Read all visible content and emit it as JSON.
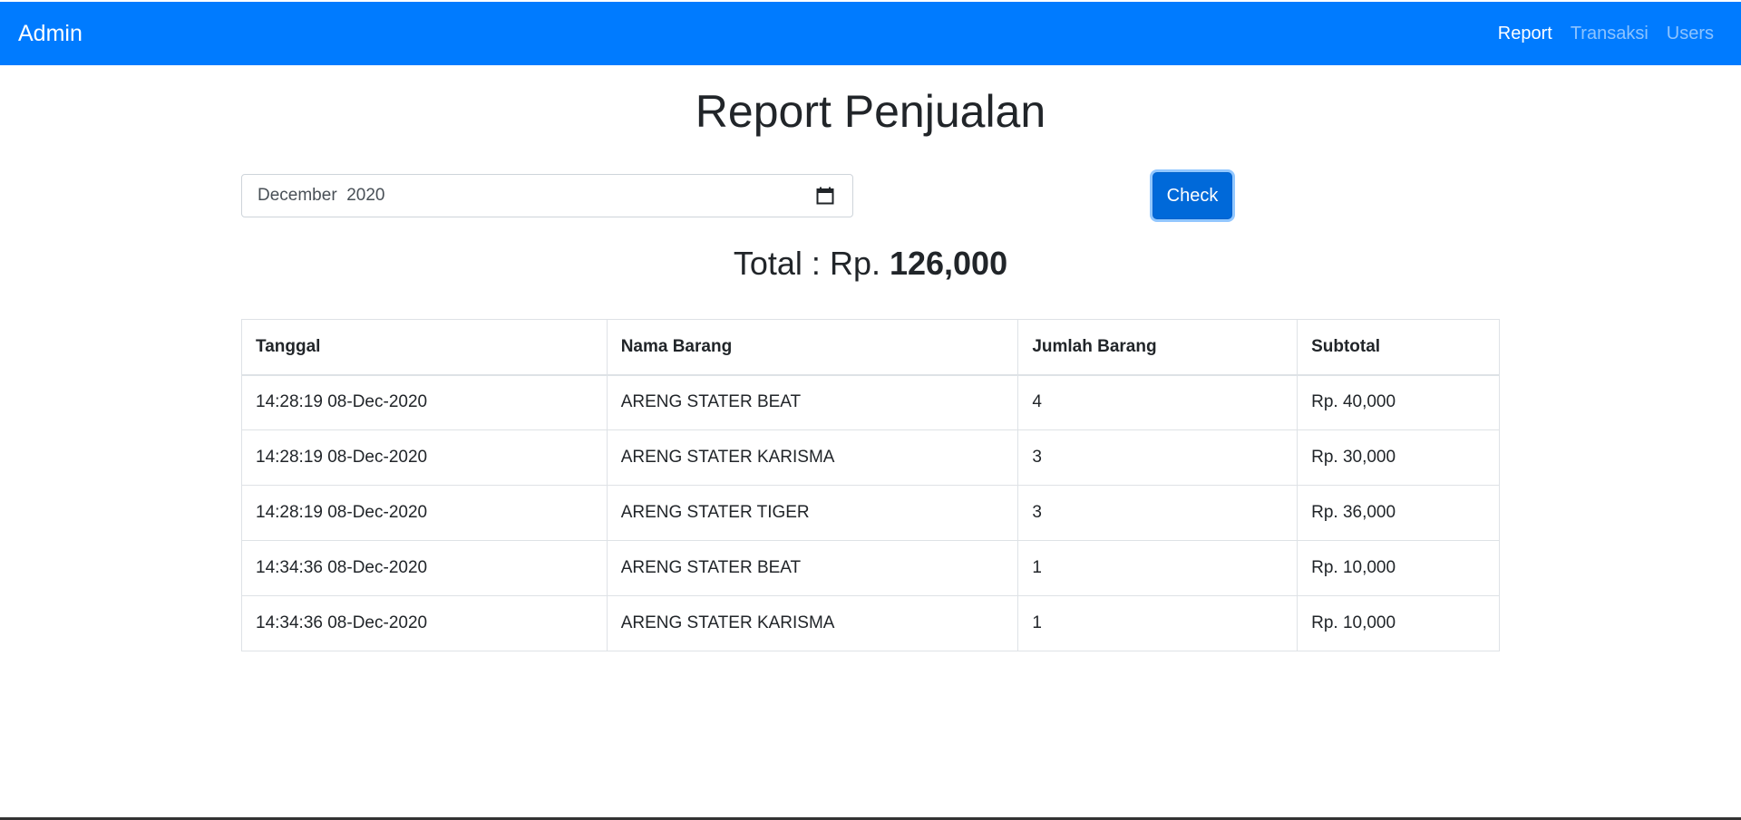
{
  "navbar": {
    "brand": "Admin",
    "links": [
      {
        "label": "Report",
        "active": true
      },
      {
        "label": "Transaksi",
        "active": false
      },
      {
        "label": "Users",
        "active": false
      }
    ],
    "color": "#007bff"
  },
  "page": {
    "title": "Report Penjualan"
  },
  "filter": {
    "month_value": "December  2020",
    "calendar_icon": "calendar-icon",
    "check_label": "Check"
  },
  "summary": {
    "total_label": "Total : Rp. ",
    "total_value": "126,000"
  },
  "table": {
    "headers": [
      "Tanggal",
      "Nama Barang",
      "Jumlah Barang",
      "Subtotal"
    ],
    "rows": [
      [
        "14:28:19 08-Dec-2020",
        "ARENG STATER BEAT",
        "4",
        "Rp. 40,000"
      ],
      [
        "14:28:19 08-Dec-2020",
        "ARENG STATER KARISMA",
        "3",
        "Rp. 30,000"
      ],
      [
        "14:28:19 08-Dec-2020",
        "ARENG STATER TIGER",
        "3",
        "Rp. 36,000"
      ],
      [
        "14:34:36 08-Dec-2020",
        "ARENG STATER BEAT",
        "1",
        "Rp. 10,000"
      ],
      [
        "14:34:36 08-Dec-2020",
        "ARENG STATER KARISMA",
        "1",
        "Rp. 10,000"
      ]
    ]
  }
}
